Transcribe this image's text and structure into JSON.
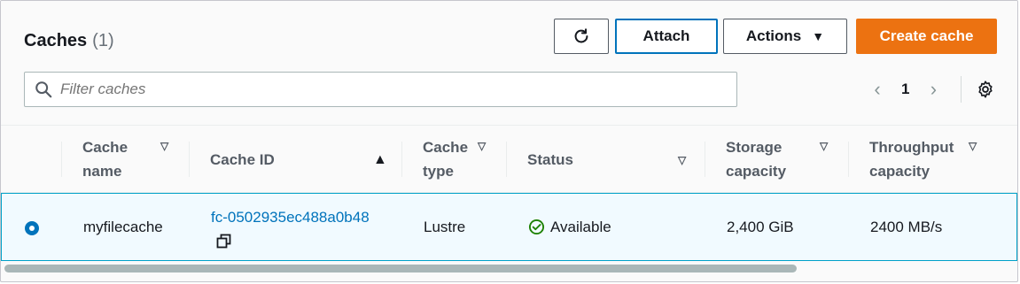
{
  "header": {
    "title": "Caches",
    "count": "(1)",
    "refresh_icon": "refresh-icon",
    "attach_label": "Attach",
    "actions_label": "Actions",
    "actions_caret": "▼",
    "create_label": "Create cache",
    "accent_color": "#ec7211",
    "focus_color": "#0073bb"
  },
  "filter": {
    "placeholder": "Filter caches",
    "icon": "search-icon"
  },
  "pagination": {
    "prev": "‹",
    "page": "1",
    "next": "›",
    "settings_icon": "gear-icon"
  },
  "table": {
    "columns": [
      {
        "label_line1": "Cache",
        "label_line2": "name",
        "sort": "▽"
      },
      {
        "label_line1": "Cache ID",
        "label_line2": "",
        "sort": "▲"
      },
      {
        "label_line1": "Cache",
        "label_line2": "type",
        "sort": "▽"
      },
      {
        "label_line1": "Status",
        "label_line2": "",
        "sort": "▽"
      },
      {
        "label_line1": "Storage",
        "label_line2": "capacity",
        "sort": "▽"
      },
      {
        "label_line1": "Throughput",
        "label_line2": "capacity",
        "sort": "▽"
      }
    ],
    "rows": [
      {
        "selected": true,
        "name": "myfilecache",
        "id": "fc-0502935ec488a0b48",
        "type": "Lustre",
        "status": "Available",
        "status_color": "#1d8102",
        "storage": "2,400 GiB",
        "throughput": "2400 MB/s"
      }
    ]
  }
}
